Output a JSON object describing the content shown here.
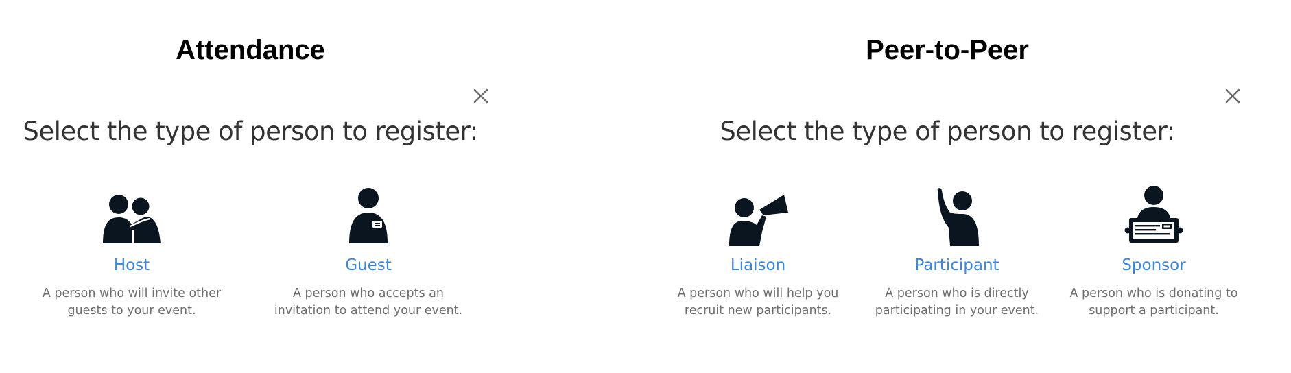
{
  "attendance": {
    "title": "Attendance",
    "prompt": "Select the type of person to register:",
    "options": [
      {
        "label": "Host",
        "desc_line1": "A person who will invite other",
        "desc_line2": "guests to your event.",
        "icon": "host-icon"
      },
      {
        "label": "Guest",
        "desc_line1": "A person who accepts an",
        "desc_line2": "invitation to attend your event.",
        "icon": "guest-icon"
      }
    ]
  },
  "p2p": {
    "title": "Peer-to-Peer",
    "prompt": "Select the type of person to register:",
    "options": [
      {
        "label": "Liaison",
        "desc_line1": "A person who will help you",
        "desc_line2": "recruit new participants.",
        "icon": "megaphone-person-icon"
      },
      {
        "label": "Participant",
        "desc_line1": "A person who is directly",
        "desc_line2": "participating in your event.",
        "icon": "raised-hand-person-icon"
      },
      {
        "label": "Sponsor",
        "desc_line1": "A person who is donating to",
        "desc_line2": "support a participant.",
        "icon": "sponsor-check-icon"
      }
    ]
  },
  "colors": {
    "accent": "#3d86d9",
    "icon": "#0a1520",
    "muted": "#6f6f6f",
    "heading": "#000000",
    "prompt": "#333333"
  }
}
